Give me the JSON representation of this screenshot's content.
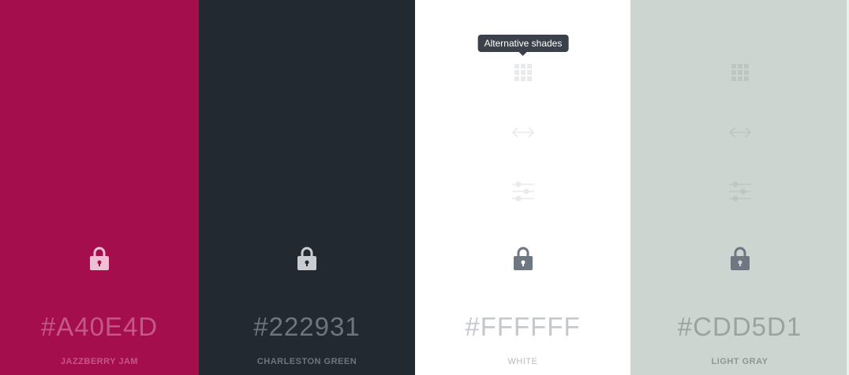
{
  "tooltip": {
    "text": "Alternative shades"
  },
  "swatches": [
    {
      "hex": "#A40E4D",
      "name": "JAZZBERRY JAM",
      "bg": "#A40E4D",
      "hex_color": "#C55786",
      "name_color": "#C55786",
      "icon_color": "#E8B3C9",
      "lock_color": "#F1BFD3",
      "tools_visible": false
    },
    {
      "hex": "#222931",
      "name": "CHARLESTON GREEN",
      "bg": "#222931",
      "hex_color": "#6F757C",
      "name_color": "#6F757C",
      "icon_color": "#3A424C",
      "lock_color": "#C9CDD2",
      "tools_visible": false
    },
    {
      "hex": "#FFFFFF",
      "name": "WHITE",
      "bg": "#FFFFFF",
      "hex_color": "#C4C7CB",
      "name_color": "#B8BCC1",
      "icon_color": "#E8EAEC",
      "lock_color": "#6E7782",
      "tools_visible": true
    },
    {
      "hex": "#CDD5D1",
      "name": "LIGHT GRAY",
      "bg": "#CDD5D1",
      "hex_color": "#9BA2A0",
      "name_color": "#8F9794",
      "icon_color": "#BEC6C2",
      "lock_color": "#6E7782",
      "tools_visible": true
    }
  ],
  "icons": {
    "shades": "grid-icon",
    "compare": "arrows-horizontal-icon",
    "adjust": "sliders-icon",
    "lock": "lock-icon"
  }
}
